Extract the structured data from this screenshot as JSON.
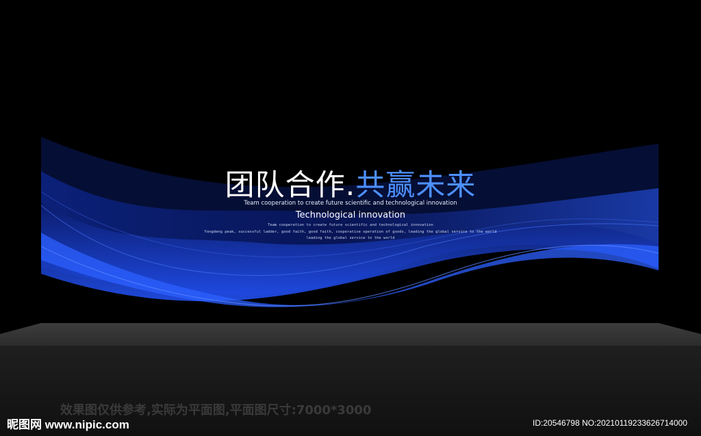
{
  "banner": {
    "title_part1": "团队合作.",
    "title_part2": "共赢未来",
    "subtitle": "Team cooperation to create future scientific and technological innovation",
    "heading2": "Technological innovation",
    "small_line1": "Team cooperation to create future scientific and technological innovation",
    "small_line2": "Yongdeng peak, successful ladder, good faith, good faith, cooperative operation of goods, leading the global service to the world",
    "small_line3": "leading the global service to the world"
  },
  "caption": "效果图仅供参考,实际为平面图,平面图尺寸:7000*3000",
  "watermark": {
    "logo_text": "昵图网 www.nipic.com",
    "id_text": "ID:20546798 NO:20210119233626714000"
  },
  "colors": {
    "background": "#000000",
    "wave_blue": "#1f4fe0",
    "title_blue": "#4d8fff",
    "floor": "#3d3d3d",
    "floor_bottom": "#161616"
  }
}
